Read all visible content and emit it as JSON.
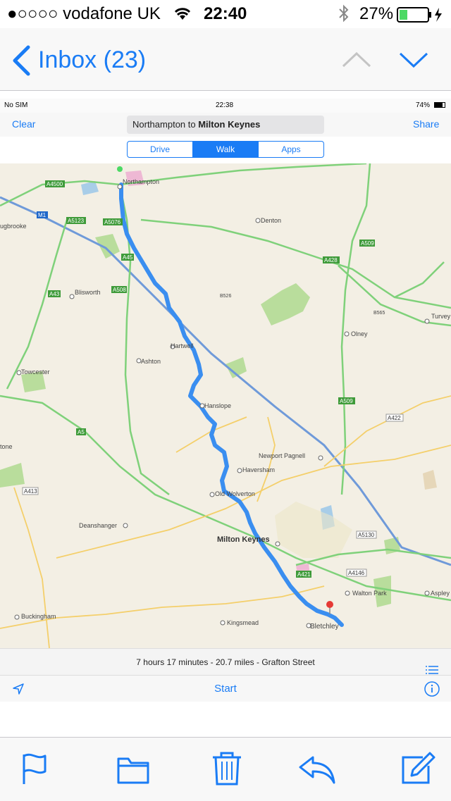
{
  "status_bar": {
    "carrier": "●○○○○ vodafone UK",
    "time": "22:40",
    "battery_pct": "27%"
  },
  "nav": {
    "back_label": "Inbox (23)"
  },
  "embedded": {
    "status": {
      "carrier": "No SIM",
      "time": "22:38",
      "battery": "74%"
    },
    "clear_label": "Clear",
    "share_label": "Share",
    "search_from": "Northampton to ",
    "search_to": "Milton Keynes",
    "segments": [
      "Drive",
      "Walk",
      "Apps"
    ],
    "active_segment": 1,
    "route_info": "7 hours 17 minutes - 20.7 miles - Grafton Street",
    "start_label": "Start",
    "map_labels": {
      "northampton": "Northampton",
      "denton": "Denton",
      "blisworth": "Blisworth",
      "hartwell": "Hartwell",
      "ashton": "Ashton",
      "towcester": "Towcester",
      "hanslope": "Hanslope",
      "olney": "Olney",
      "newport_pagnell": "Newport Pagnell",
      "haversham": "Haversham",
      "old_wolverton": "Old Wolverton",
      "deanshanger": "Deanshanger",
      "milton_keynes": "Milton Keynes",
      "walton_park": "Walton Park",
      "buckingham": "Buckingham",
      "kingsmead": "Kingsmead",
      "bletchley": "Bletchley",
      "turvey": "Turvey",
      "aspley": "Aspley",
      "ugbrooke": "ugbrooke",
      "tone": "tone"
    },
    "road_labels": [
      "A4500",
      "A5123",
      "A5076",
      "A45",
      "A43",
      "A508",
      "A428",
      "A509",
      "A5",
      "A422",
      "A413",
      "A421",
      "A5130",
      "A4146",
      "M1",
      "B526",
      "B565",
      "A509"
    ]
  },
  "toolbar": {
    "icons": [
      "flag-icon",
      "folder-icon",
      "trash-icon",
      "reply-icon",
      "compose-icon"
    ]
  },
  "colors": {
    "accent": "#1a7cf5",
    "route": "#3a8ef0",
    "map_bg": "#f3efe4",
    "road_green": "#7fd17a",
    "motorway": "#6f9ad9"
  }
}
